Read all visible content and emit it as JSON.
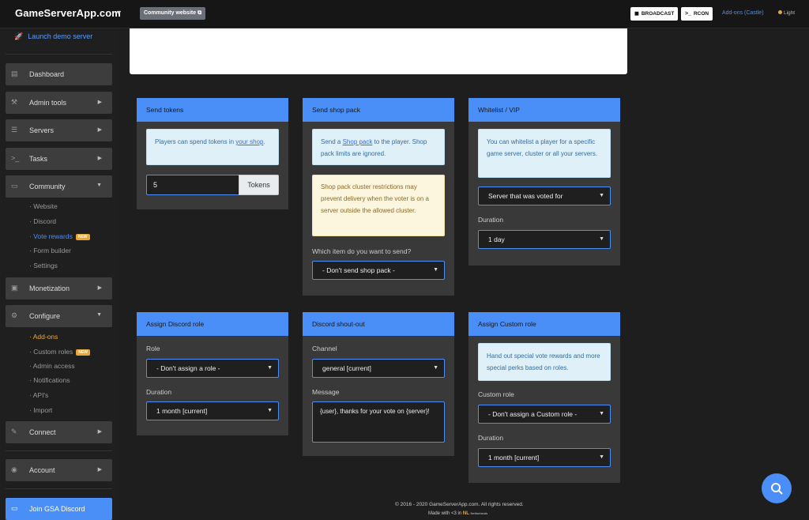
{
  "topbar": {
    "brand": "GameServerApp.com",
    "community_button": "Community website",
    "broadcast_label": "BROADCAST",
    "rcon_label": "RCON",
    "addons_link": "Add-ons (Castle)",
    "theme_label": "Light"
  },
  "sidebar": {
    "launch": "Launch demo server",
    "nav": {
      "dashboard": "Dashboard",
      "admin_tools": "Admin tools",
      "servers": "Servers",
      "tasks": "Tasks",
      "community": "Community",
      "monetization": "Monetization",
      "configure": "Configure",
      "connect": "Connect",
      "account": "Account",
      "join_discord": "Join GSA Discord"
    },
    "community_sub": [
      "Website",
      "Discord",
      "Vote rewards",
      "Form builder",
      "Settings"
    ],
    "configure_sub": [
      "Add-ons",
      "Custom roles",
      "Admin access",
      "Notifications",
      "API's",
      "Import"
    ],
    "new_badge": "NEW"
  },
  "cards": {
    "send_tokens": {
      "title": "Send tokens",
      "info_pre": "Players can spend tokens in ",
      "info_link": "your shop",
      "info_post": ".",
      "token_value": "5",
      "token_addon": "Tokens"
    },
    "send_shop_pack": {
      "title": "Send shop pack",
      "info_pre": "Send a ",
      "info_link": "Shop pack",
      "info_post": " to the player. Shop pack limits are ignored.",
      "warning": "Shop pack cluster restrictions may prevent delivery when the voter is on a server outside the allowed cluster.",
      "label": "Which item do you want to send?",
      "select": "- Don't send shop pack -"
    },
    "whitelist": {
      "title": "Whitelist / VIP",
      "info": "You can whitelist a player for a specific game server, cluster or all your servers.",
      "server_select": "Server that was voted for",
      "duration_label": "Duration",
      "duration_select": "1 day"
    },
    "discord_role": {
      "title": "Assign Discord role",
      "role_label": "Role",
      "role_select": "- Don't assign a role -",
      "duration_label": "Duration",
      "duration_select": "1 month [current]"
    },
    "shout_out": {
      "title": "Discord shout-out",
      "channel_label": "Channel",
      "channel_select": "general [current]",
      "message_label": "Message",
      "message_value": "{user}, thanks for your vote on {server}!"
    },
    "custom_role": {
      "title": "Assign Custom role",
      "info": "Hand out special vote rewards and more special perks based on roles.",
      "role_label": "Custom role",
      "role_select": "- Don't assign a Custom role -",
      "duration_label": "Duration",
      "duration_select": "1 month [current]"
    }
  },
  "footer": {
    "copyright": "© 2016 - 2020 GameServerApp.com. All rights reserved.",
    "made_with": "Made with <3 in",
    "nl": "NL",
    "country": "Netherlands"
  },
  "colors": {
    "accent": "#4a8ef7",
    "new_badge": "#e9a63b",
    "info_bg": "#dff0f8",
    "warning_bg": "#fcf6df"
  },
  "icons": {
    "launch": "rocket-icon",
    "dashboard": "chart-icon",
    "admin_tools": "wrench-icon",
    "servers": "server-icon",
    "tasks": "terminal-icon",
    "community": "window-icon",
    "monetization": "money-icon",
    "configure": "gear-icon",
    "connect": "plug-icon",
    "account": "user-icon",
    "support": "search-icon"
  }
}
